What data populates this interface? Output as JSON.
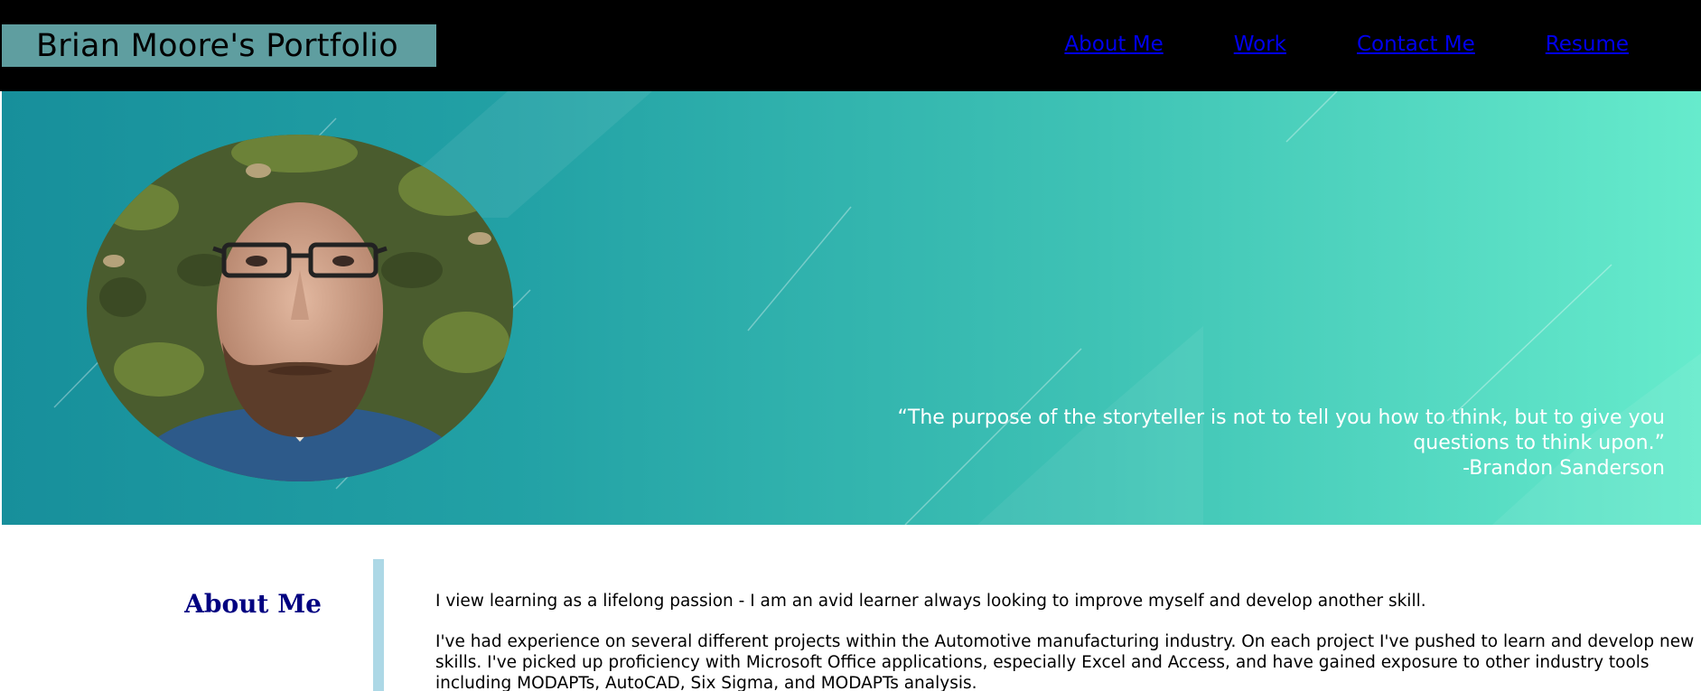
{
  "header": {
    "brand": "Brian Moore's Portfolio",
    "nav": [
      {
        "label": "About Me"
      },
      {
        "label": "Work"
      },
      {
        "label": "Contact Me"
      },
      {
        "label": "Resume"
      }
    ]
  },
  "hero": {
    "quote": "“The purpose of the storyteller is not to tell you how to think, but to give you questions to think upon.”",
    "author": "-Brandon Sanderson"
  },
  "about": {
    "heading": "About Me",
    "paragraphs": [
      "I view learning as a lifelong passion - I am an avid learner always looking to improve myself and develop another skill.",
      "I've had experience on several different projects within the Automotive manufacturing industry. On each project I've pushed to learn and develop new skills. I've picked up proficiency with Microsoft Office applications, especially Excel and Access, and have gained exposure to other industry tools including MODAPTs, AutoCAD, Six Sigma, and MODAPTs analysis."
    ]
  },
  "colors": {
    "header_bg": "#000000",
    "brand_bg": "#5f9ea0",
    "link": "#0000ee",
    "hero_start": "#178f9b",
    "hero_end": "#66ebcc",
    "heading": "#000080",
    "divider": "#add8e6"
  }
}
